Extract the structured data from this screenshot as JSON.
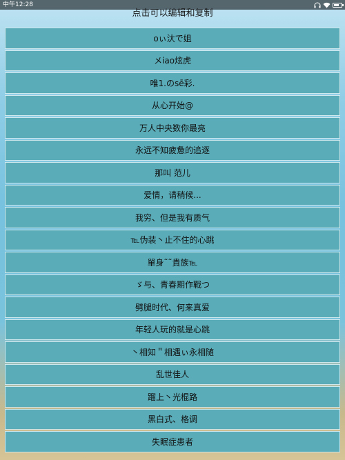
{
  "status_bar": {
    "time": "中午12:28",
    "icons": [
      "headphones-icon",
      "wifi-icon",
      "battery-icon"
    ],
    "battery_level": 0.7
  },
  "header": {
    "title": "点击可以编辑和复制"
  },
  "list": {
    "items": [
      "oぃ汏で姐",
      "メiao炫虎",
      "唯1.のsē彩.",
      "从心开始@",
      "万人中央数你最亮",
      "永远不知疲惫的追逐",
      "那叫 范儿",
      "爱情，请稍候...",
      "我穷、但是我有质气",
      "℡伪装丶止不住的心跳",
      "單身˜˜貴族℡",
      "ゞ与、青春期作戰つ",
      "劈腿时代、何来真爱",
      "年轻人玩的就是心跳",
      "丶相知＂相遇ぃ永相随",
      "乱世佳人",
      "蹓上丶光棍路",
      "黑白式、格调",
      "失眠症患者"
    ]
  },
  "colors": {
    "item_background": "#5aacb8",
    "item_border": "#cfe8ee",
    "text": "#111111"
  }
}
